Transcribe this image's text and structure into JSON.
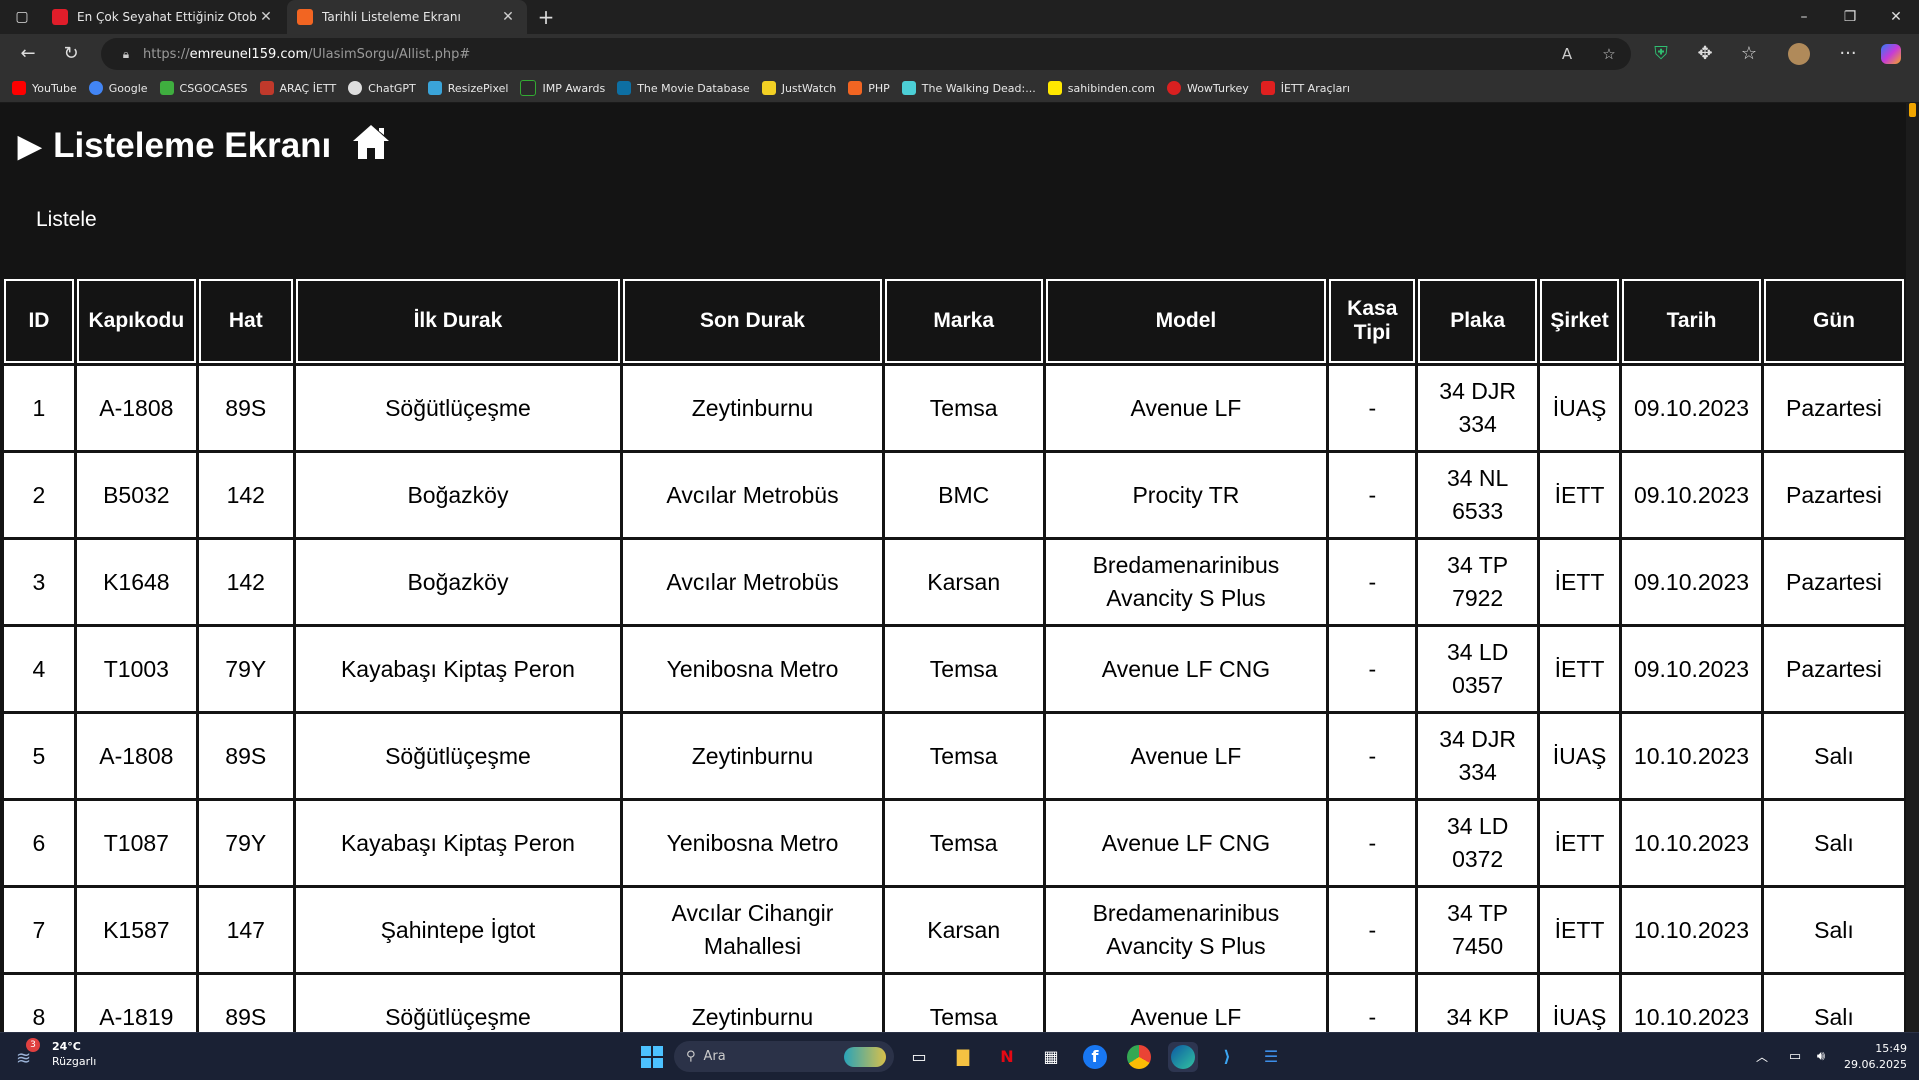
{
  "browser": {
    "tabs": [
      {
        "title": "En Çok Seyahat Ettiğiniz Otobüs&",
        "active": false
      },
      {
        "title": "Tarihli Listeleme Ekranı",
        "active": true
      }
    ],
    "url_prefix": "https://",
    "url_domain": "emreunel159.com",
    "url_path": "/UlasimSorgu/Allist.php#",
    "bookmarks": [
      {
        "label": "YouTube",
        "color": "#ff0000"
      },
      {
        "label": "Google",
        "color": "#4285f4"
      },
      {
        "label": "CSGOCASES",
        "color": "#3fae3f"
      },
      {
        "label": "ARAÇ İETT",
        "color": "#c0392b"
      },
      {
        "label": "ChatGPT",
        "color": "#dddddd"
      },
      {
        "label": "ResizePixel",
        "color": "#3aa4d9"
      },
      {
        "label": "IMP Awards",
        "color": "#2a2a2a"
      },
      {
        "label": "The Movie Database",
        "color": "#0d6fa3"
      },
      {
        "label": "JustWatch",
        "color": "#f2d024"
      },
      {
        "label": "PHP",
        "color": "#f26522"
      },
      {
        "label": "The Walking Dead:...",
        "color": "#4ccfd6"
      },
      {
        "label": "sahibinden.com",
        "color": "#ffe800"
      },
      {
        "label": "WowTurkey",
        "color": "#d92020"
      },
      {
        "label": "İETT Araçları",
        "color": "#e02020"
      }
    ]
  },
  "page": {
    "title": "Listeleme Ekranı",
    "subtitle": "Listele"
  },
  "table": {
    "headers": [
      "ID",
      "Kapıkodu",
      "Hat",
      "İlk Durak",
      "Son Durak",
      "Marka",
      "Model",
      "Kasa Tipi",
      "Plaka",
      "Şirket",
      "Tarih",
      "Gün"
    ],
    "rows": [
      [
        "1",
        "A-1808",
        "89S",
        "Söğütlüçeşme",
        "Zeytinburnu",
        "Temsa",
        "Avenue LF",
        "-",
        "34 DJR 334",
        "İUAŞ",
        "09.10.2023",
        "Pazartesi"
      ],
      [
        "2",
        "B5032",
        "142",
        "Boğazköy",
        "Avcılar Metrobüs",
        "BMC",
        "Procity TR",
        "-",
        "34 NL 6533",
        "İETT",
        "09.10.2023",
        "Pazartesi"
      ],
      [
        "3",
        "K1648",
        "142",
        "Boğazköy",
        "Avcılar Metrobüs",
        "Karsan",
        "Bredamenarinibus Avancity S Plus",
        "-",
        "34 TP 7922",
        "İETT",
        "09.10.2023",
        "Pazartesi"
      ],
      [
        "4",
        "T1003",
        "79Y",
        "Kayabaşı Kiptaş Peron",
        "Yenibosna Metro",
        "Temsa",
        "Avenue LF CNG",
        "-",
        "34 LD 0357",
        "İETT",
        "09.10.2023",
        "Pazartesi"
      ],
      [
        "5",
        "A-1808",
        "89S",
        "Söğütlüçeşme",
        "Zeytinburnu",
        "Temsa",
        "Avenue LF",
        "-",
        "34 DJR 334",
        "İUAŞ",
        "10.10.2023",
        "Salı"
      ],
      [
        "6",
        "T1087",
        "79Y",
        "Kayabaşı Kiptaş Peron",
        "Yenibosna Metro",
        "Temsa",
        "Avenue LF CNG",
        "-",
        "34 LD 0372",
        "İETT",
        "10.10.2023",
        "Salı"
      ],
      [
        "7",
        "K1587",
        "147",
        "Şahintepe İgtot",
        "Avcılar Cihangir Mahallesi",
        "Karsan",
        "Bredamenarinibus Avancity S Plus",
        "-",
        "34 TP 7450",
        "İETT",
        "10.10.2023",
        "Salı"
      ],
      [
        "8",
        "A-1819",
        "89S",
        "Söğütlüçeşme",
        "Zeytinburnu",
        "Temsa",
        "Avenue LF",
        "-",
        "34 KP",
        "İUAŞ",
        "10.10.2023",
        "Salı"
      ]
    ]
  },
  "taskbar": {
    "weather_temp": "24°C",
    "weather_desc": "Rüzgarlı",
    "weather_badge": "3",
    "search_placeholder": "Ara",
    "time": "15:49",
    "date": "29.06.2025"
  }
}
